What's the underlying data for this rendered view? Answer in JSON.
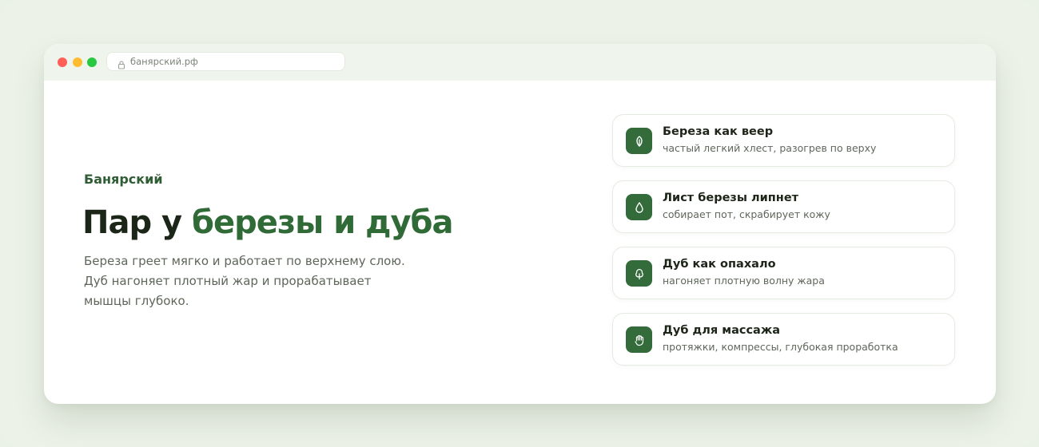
{
  "browser": {
    "url": "банярский.рф"
  },
  "hero": {
    "brand": "Банярский",
    "headline_start": "Пар у ",
    "headline_accent": "березы и дуба",
    "description": "Береза греет мягко и работает по верхнему слою. Дуб нагоняет плотный жар и прорабатывает мышцы глубоко."
  },
  "cards": [
    {
      "icon": "leaf-icon",
      "title": "Береза как веер",
      "subtitle": "частый легкий хлест, разогрев по верху"
    },
    {
      "icon": "drop-icon",
      "title": "Лист березы липнет",
      "subtitle": "собирает пот, скрабирует кожу"
    },
    {
      "icon": "tree-icon",
      "title": "Дуб как опахало",
      "subtitle": "нагоняет плотную волну жара"
    },
    {
      "icon": "hand-icon",
      "title": "Дуб для массажа",
      "subtitle": "протяжки, компрессы, глубокая проработка"
    }
  ],
  "colors": {
    "accent": "#2f6a37",
    "icon_bg": "#336b3a",
    "background": "#ecf2e8"
  }
}
